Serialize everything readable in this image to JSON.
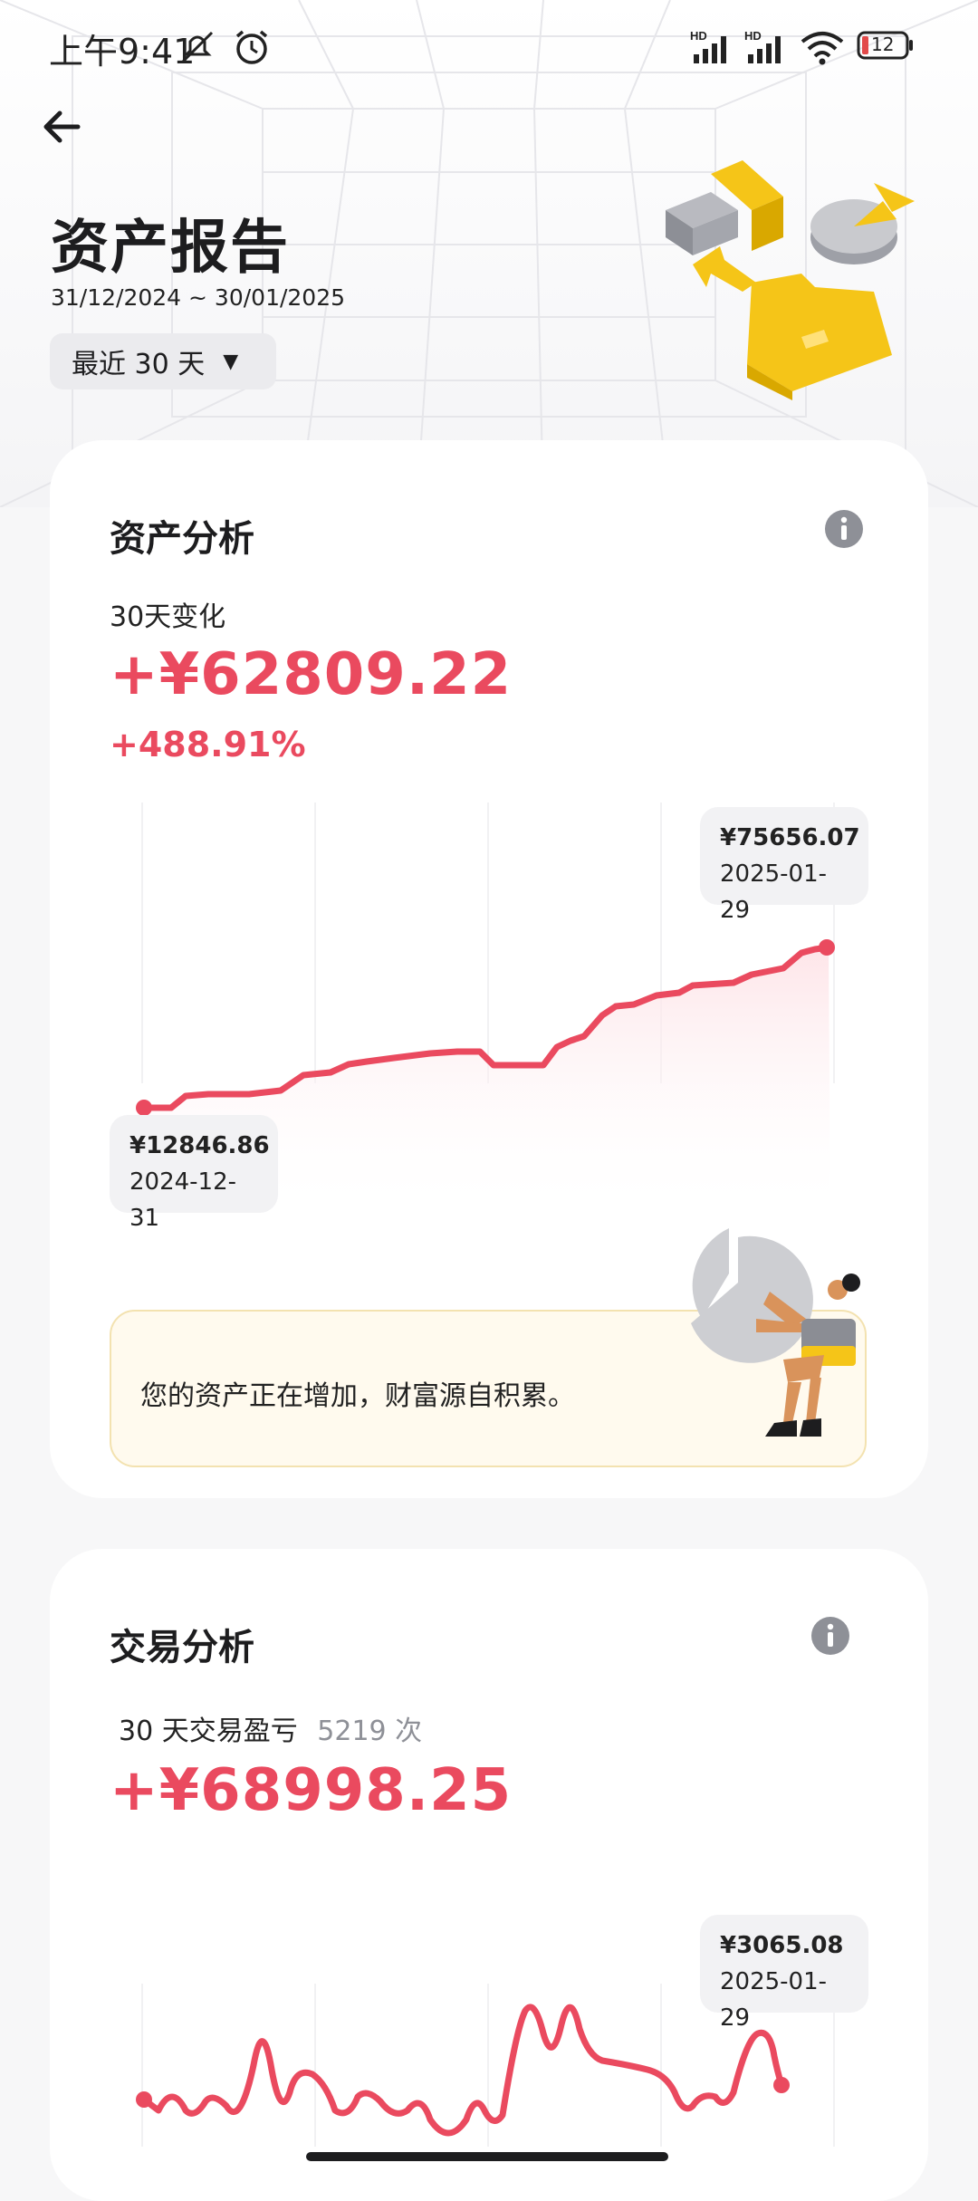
{
  "status_bar": {
    "time": "上午9:41",
    "battery": "12",
    "icons": [
      "mute-icon",
      "alarm-icon",
      "signal-hd-icon",
      "signal-hd-icon",
      "wifi-icon",
      "battery-icon"
    ]
  },
  "header": {
    "back_icon": "arrow-left-icon",
    "title": "资产报告",
    "date_range": "31/12/2024 ~ 30/01/2025",
    "range_select": "最近 30 天"
  },
  "asset_card": {
    "title": "资产分析",
    "change_label": "30天变化",
    "change_value": "+¥62809.22",
    "change_pct": "+488.91%",
    "tooltip_end": {
      "value": "¥75656.07",
      "date": "2025-01-29"
    },
    "tooltip_start": {
      "value": "¥12846.86",
      "date": "2024-12-31"
    },
    "note": "您的资产正在增加，财富源自积累。"
  },
  "trade_card": {
    "title": "交易分析",
    "pnl_label": "30 天交易盈亏",
    "trade_count": "5219 次",
    "pnl_value": "+¥68998.25",
    "tooltip": {
      "value": "¥3065.08",
      "date": "2025-01-29"
    }
  },
  "colors": {
    "accent": "#ea4a5f",
    "background": "#f7f7f8",
    "card": "#ffffff",
    "note_bg": "#fffaee"
  }
}
